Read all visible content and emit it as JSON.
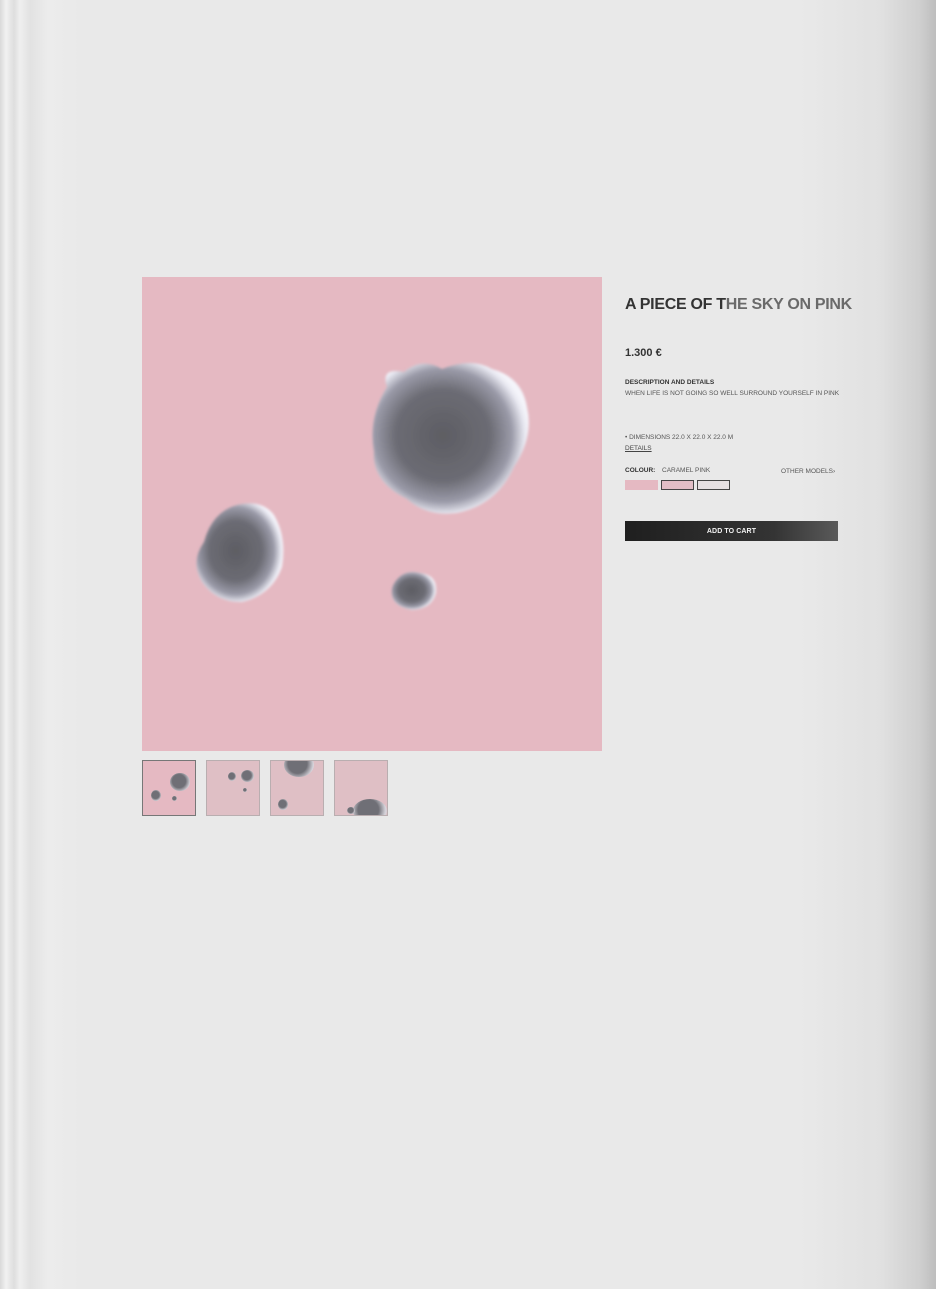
{
  "product": {
    "title_part1": "A PIECE OF T",
    "title_part2": "HE SKY ON PINK",
    "price": "1.300 €",
    "description_heading": "DESCRIPTION AND DETAILS",
    "description": "WHEN LIFE IS NOT GOING SO WELL SURROUND YOURSELF IN PINK",
    "dimensions": "• DIMENSIONS  22.0 X 22.0 X 22.0 M",
    "details_link": "DETAILS",
    "colour_label": "COLOUR:",
    "colour_value": "CARAMEL PINK",
    "other_models": "OTHER MODELS›",
    "add_to_cart": "ADD TO CART"
  },
  "colors": {
    "pink": "#e5b9c2",
    "button": "#1f1f1f",
    "background": "#e7e7e7"
  },
  "swatches": [
    "caramel-pink",
    "pink-outlined",
    "light-outlined"
  ],
  "thumbnails": [
    "view-1",
    "view-2",
    "view-3",
    "view-4"
  ]
}
